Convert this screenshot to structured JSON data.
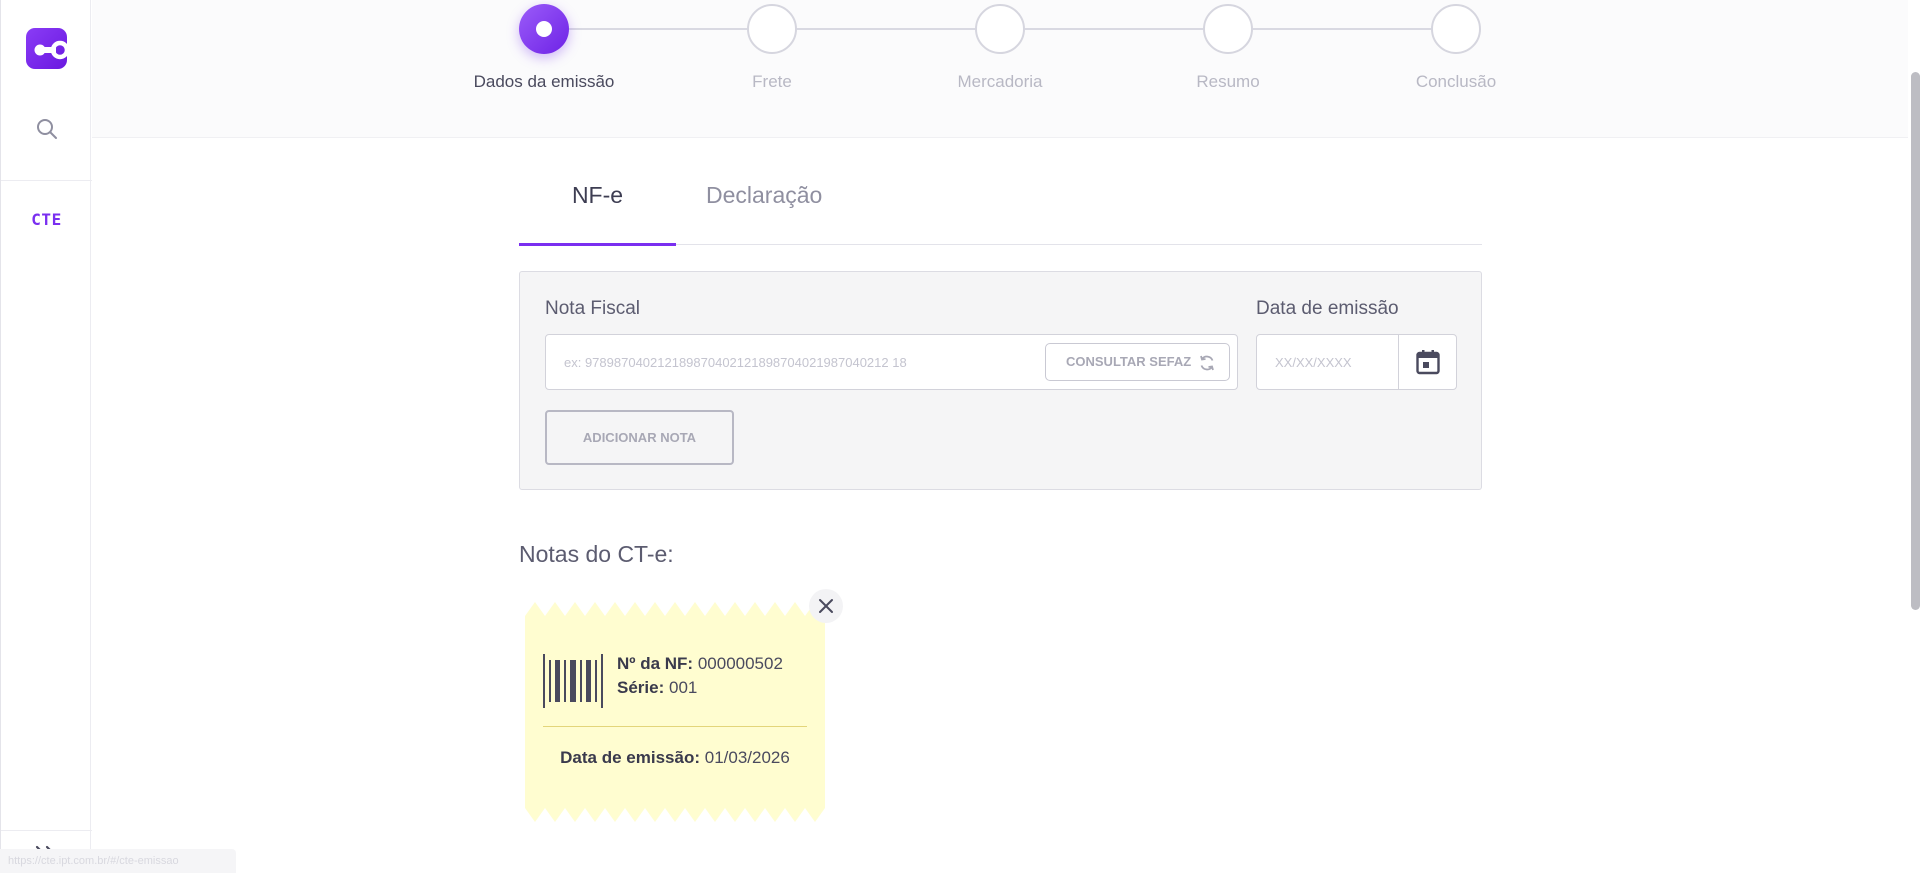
{
  "sidebar": {
    "app_module_label": "CTE",
    "status_url": "https://cte.ipt.com.br/#/cte-emissao"
  },
  "stepper": {
    "steps": [
      {
        "label": "Dados da emissão",
        "active": true
      },
      {
        "label": "Frete",
        "active": false
      },
      {
        "label": "Mercadoria",
        "active": false
      },
      {
        "label": "Resumo",
        "active": false
      },
      {
        "label": "Conclusão",
        "active": false
      }
    ]
  },
  "tabs": [
    {
      "label": "NF-e",
      "selected": true
    },
    {
      "label": "Declaração",
      "selected": false
    }
  ],
  "form": {
    "nota_fiscal_label": "Nota Fiscal",
    "nota_fiscal_placeholder": "ex: 978987040212189870402121898704021987040212 18",
    "nota_fiscal_value": "",
    "consultar_label": "CONSULTAR SEFAZ",
    "data_label": "Data de emissão",
    "data_placeholder": "XX/XX/XXXX",
    "data_value": "",
    "add_label": "ADICIONAR NOTA"
  },
  "notes": {
    "title": "Notas do CT-e:",
    "items": [
      {
        "nf_label": "Nº da NF:",
        "nf_value": "000000502",
        "serie_label": "Série:",
        "serie_value": "001",
        "date_label": "Data de emissão:",
        "date_value": "01/03/2026"
      }
    ]
  },
  "colors": {
    "accent": "#7a2ff0",
    "note_bg": "#fffdd0",
    "panel_bg": "#f5f5f6"
  },
  "icons": {
    "logo": "link-logo-icon",
    "search": "search-icon",
    "expand": "double-chevron-right-icon",
    "refresh": "refresh-icon",
    "calendar": "calendar-icon",
    "close": "close-icon",
    "barcode": "barcode-icon"
  }
}
